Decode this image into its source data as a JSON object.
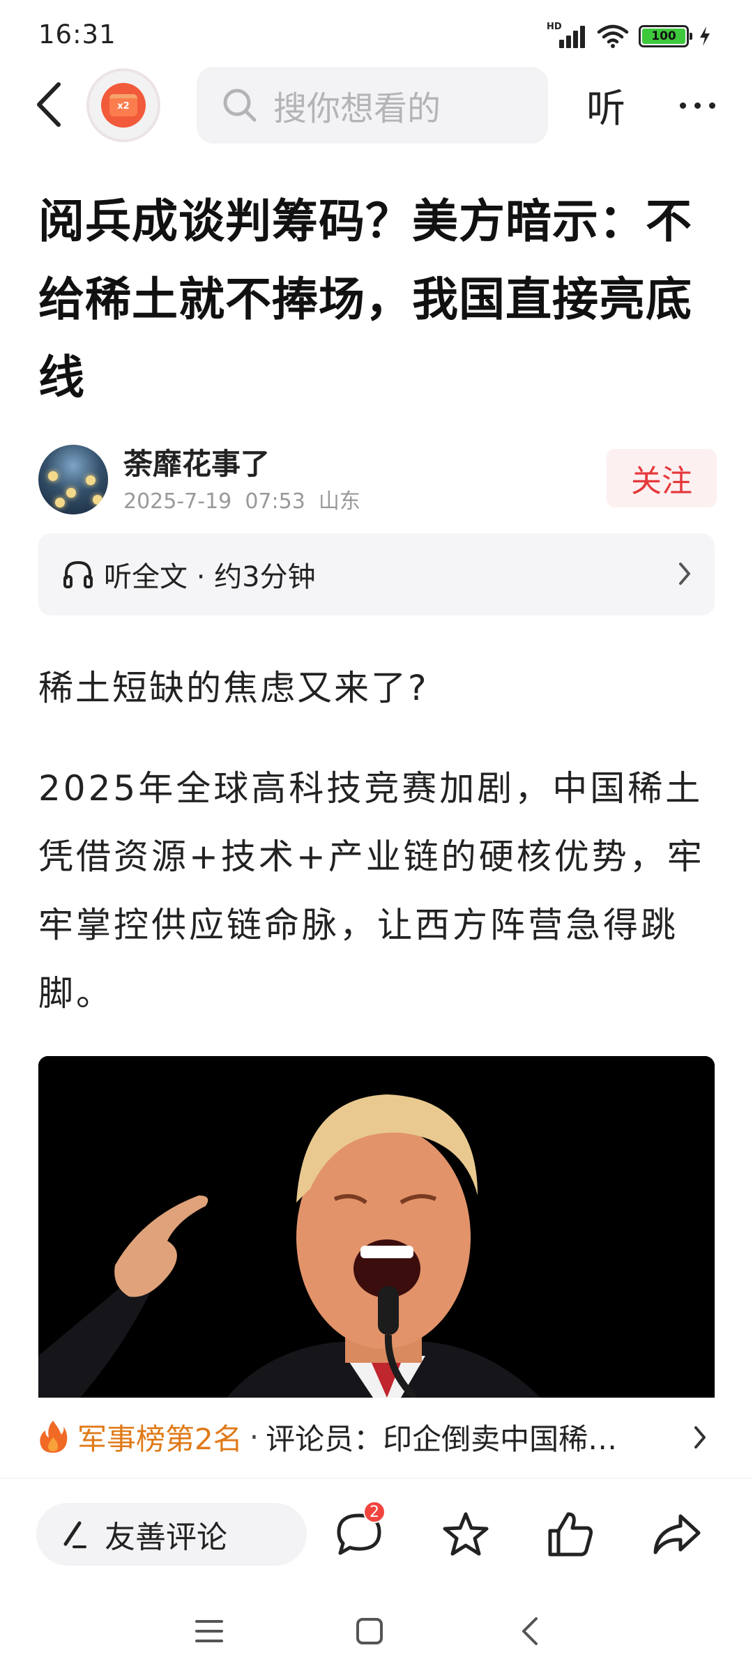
{
  "status_bar": {
    "time": "16:31",
    "network_label": "HD",
    "battery_level": "100"
  },
  "top_nav": {
    "search_placeholder": "搜你想看的",
    "listen_label": "听",
    "red_packet_multiplier": "x2"
  },
  "article": {
    "title": "阅兵成谈判筹码？美方暗示：不给稀土就不捧场，我国直接亮底线",
    "author": {
      "name": "荼靡花事了",
      "meta": "2025-7-19  07:53  山东",
      "follow_label": "关注"
    },
    "listen_bar_text": "听全文 · 约3分钟",
    "paragraphs": [
      "稀土短缺的焦虑又来了?",
      "2025年全球高科技竞赛加剧，中国稀土凭借资源+技术+产业链的硬核优势，牢牢掌控供应链命脉，让西方阵营急得跳脚。"
    ]
  },
  "hot_bar": {
    "rank_label": "军事榜第2名",
    "separator": "·",
    "headline": "评论员：印企倒卖中国稀…"
  },
  "action_bar": {
    "comment_placeholder": "友善评论",
    "comment_count": "2"
  },
  "colors": {
    "accent_red": "#e4393c",
    "hot_orange": "#e07a18",
    "battery_green": "#3ec83c"
  }
}
